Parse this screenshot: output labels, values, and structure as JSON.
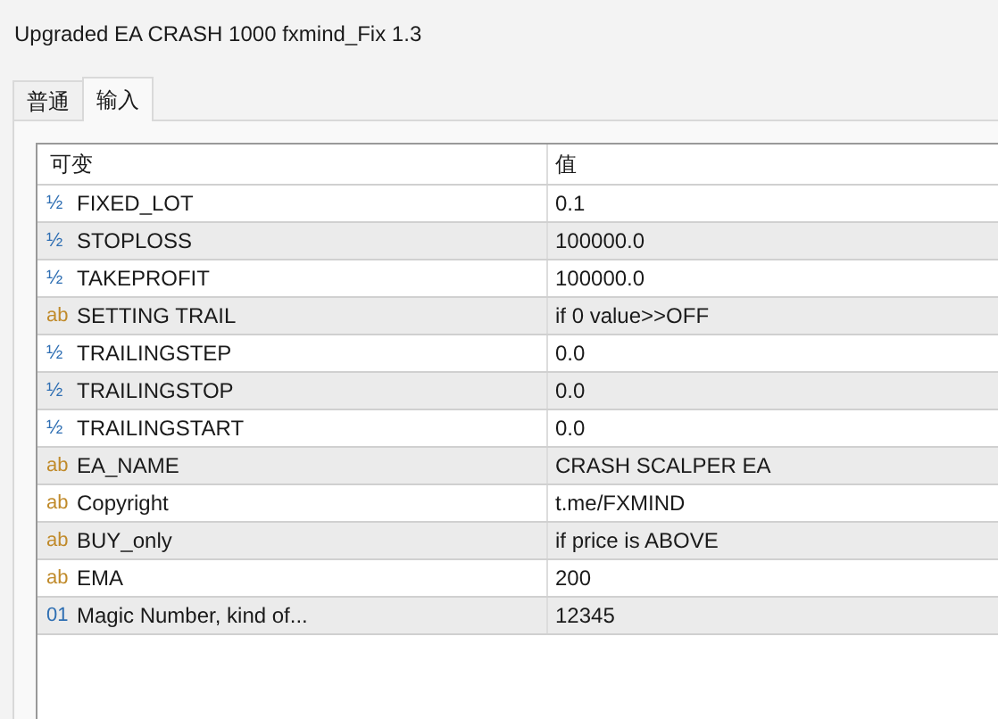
{
  "window": {
    "title": "Upgraded EA CRASH 1000 fxmind_Fix 1.3"
  },
  "tabs": [
    {
      "label": "普通",
      "selected": false
    },
    {
      "label": "输入",
      "selected": true
    }
  ],
  "table": {
    "columns": [
      "可变",
      "值"
    ],
    "rows": [
      {
        "kind": "double",
        "icon": "½",
        "name": "FIXED_LOT",
        "value": "0.1"
      },
      {
        "kind": "double",
        "icon": "½",
        "name": "STOPLOSS",
        "value": "100000.0"
      },
      {
        "kind": "double",
        "icon": "½",
        "name": "TAKEPROFIT",
        "value": "100000.0"
      },
      {
        "kind": "string",
        "icon": "ab",
        "name": "SETTING TRAIL",
        "value": "if 0 value>>OFF"
      },
      {
        "kind": "double",
        "icon": "½",
        "name": "TRAILINGSTEP",
        "value": "0.0"
      },
      {
        "kind": "double",
        "icon": "½",
        "name": "TRAILINGSTOP",
        "value": "0.0"
      },
      {
        "kind": "double",
        "icon": "½",
        "name": "TRAILINGSTART",
        "value": "0.0"
      },
      {
        "kind": "string",
        "icon": "ab",
        "name": "EA_NAME",
        "value": "CRASH SCALPER EA"
      },
      {
        "kind": "string",
        "icon": "ab",
        "name": "Copyright",
        "value": "t.me/FXMIND"
      },
      {
        "kind": "string",
        "icon": "ab",
        "name": "BUY_only",
        "value": "if price is ABOVE"
      },
      {
        "kind": "string",
        "icon": "ab",
        "name": "EMA",
        "value": "200"
      },
      {
        "kind": "integer",
        "icon": "01",
        "name": "Magic Number, kind of...",
        "value": "12345"
      }
    ]
  }
}
